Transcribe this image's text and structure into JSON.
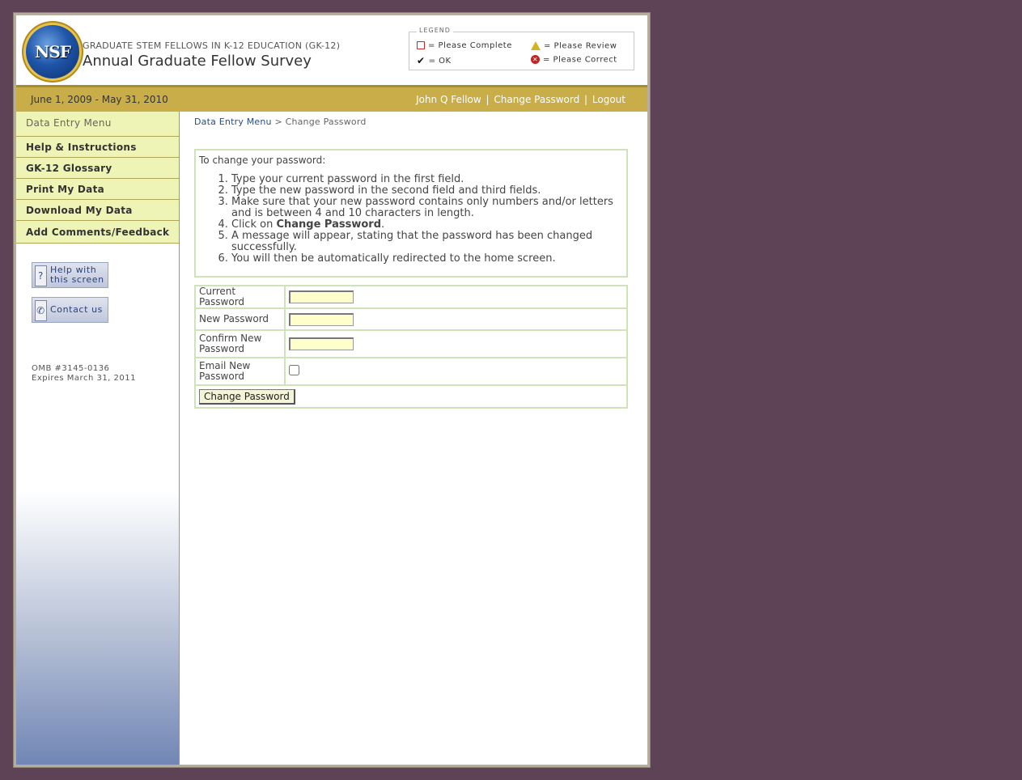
{
  "header": {
    "logo_text": "NSF",
    "program": "GRADUATE STEM FELLOWS IN K-12 EDUCATION (GK-12)",
    "title": "Annual Graduate Fellow Survey",
    "legend": {
      "title": "LEGEND",
      "please_complete": "= Please Complete",
      "ok": "= OK",
      "please_review": "= Please Review",
      "please_correct": "= Please Correct"
    }
  },
  "goldbar": {
    "dates": "June 1, 2009 - May 31, 2010",
    "user": "John Q Fellow",
    "change_password": "Change Password",
    "logout": "Logout",
    "sep": "|"
  },
  "sidebar": {
    "items": [
      "Data Entry Menu",
      "Help & Instructions",
      "GK-12 Glossary",
      "Print My Data",
      "Download My Data",
      "Add Comments/Feedback"
    ],
    "help_line1": "Help with",
    "help_line2": "this screen",
    "contact": "Contact us",
    "omb_line1": "OMB #3145-0136",
    "omb_line2": "Expires March 31, 2011"
  },
  "breadcrumb": {
    "link": "Data Entry Menu",
    "sep": ">",
    "current": "Change Password"
  },
  "instructions": {
    "intro": "To change your password:",
    "steps": [
      "Type your current password in the first field.",
      "Type the new password in the second field and third fields.",
      "Make sure that your new password contains only numbers and/or letters and is between 4 and 10 characters in length.",
      "Click on",
      "A message will appear, stating that the password has been changed successfully.",
      "You will then be automatically redirected to the home screen."
    ],
    "step4_bold": "Change Password",
    "step4_end": "."
  },
  "form": {
    "current_label": "Current Password",
    "new_label": "New Password",
    "confirm_label": "Confirm New Password",
    "email_label": "Email New Password",
    "email_checked": false,
    "submit": "Change Password"
  }
}
